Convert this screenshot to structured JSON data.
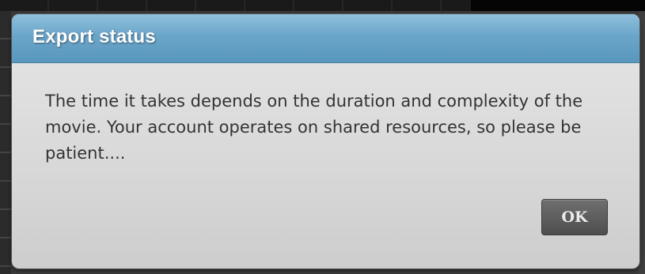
{
  "dialog": {
    "title": "Export status",
    "message": "The time it takes depends on the duration and complexity of the movie. Your account operates on shared resources, so please be patient....",
    "ok_label": "OK"
  },
  "colors": {
    "titlebar": "#6aa5c9",
    "dialog_body": "#d8d8d8",
    "button": "#5a5a5a",
    "text": "#333333"
  }
}
